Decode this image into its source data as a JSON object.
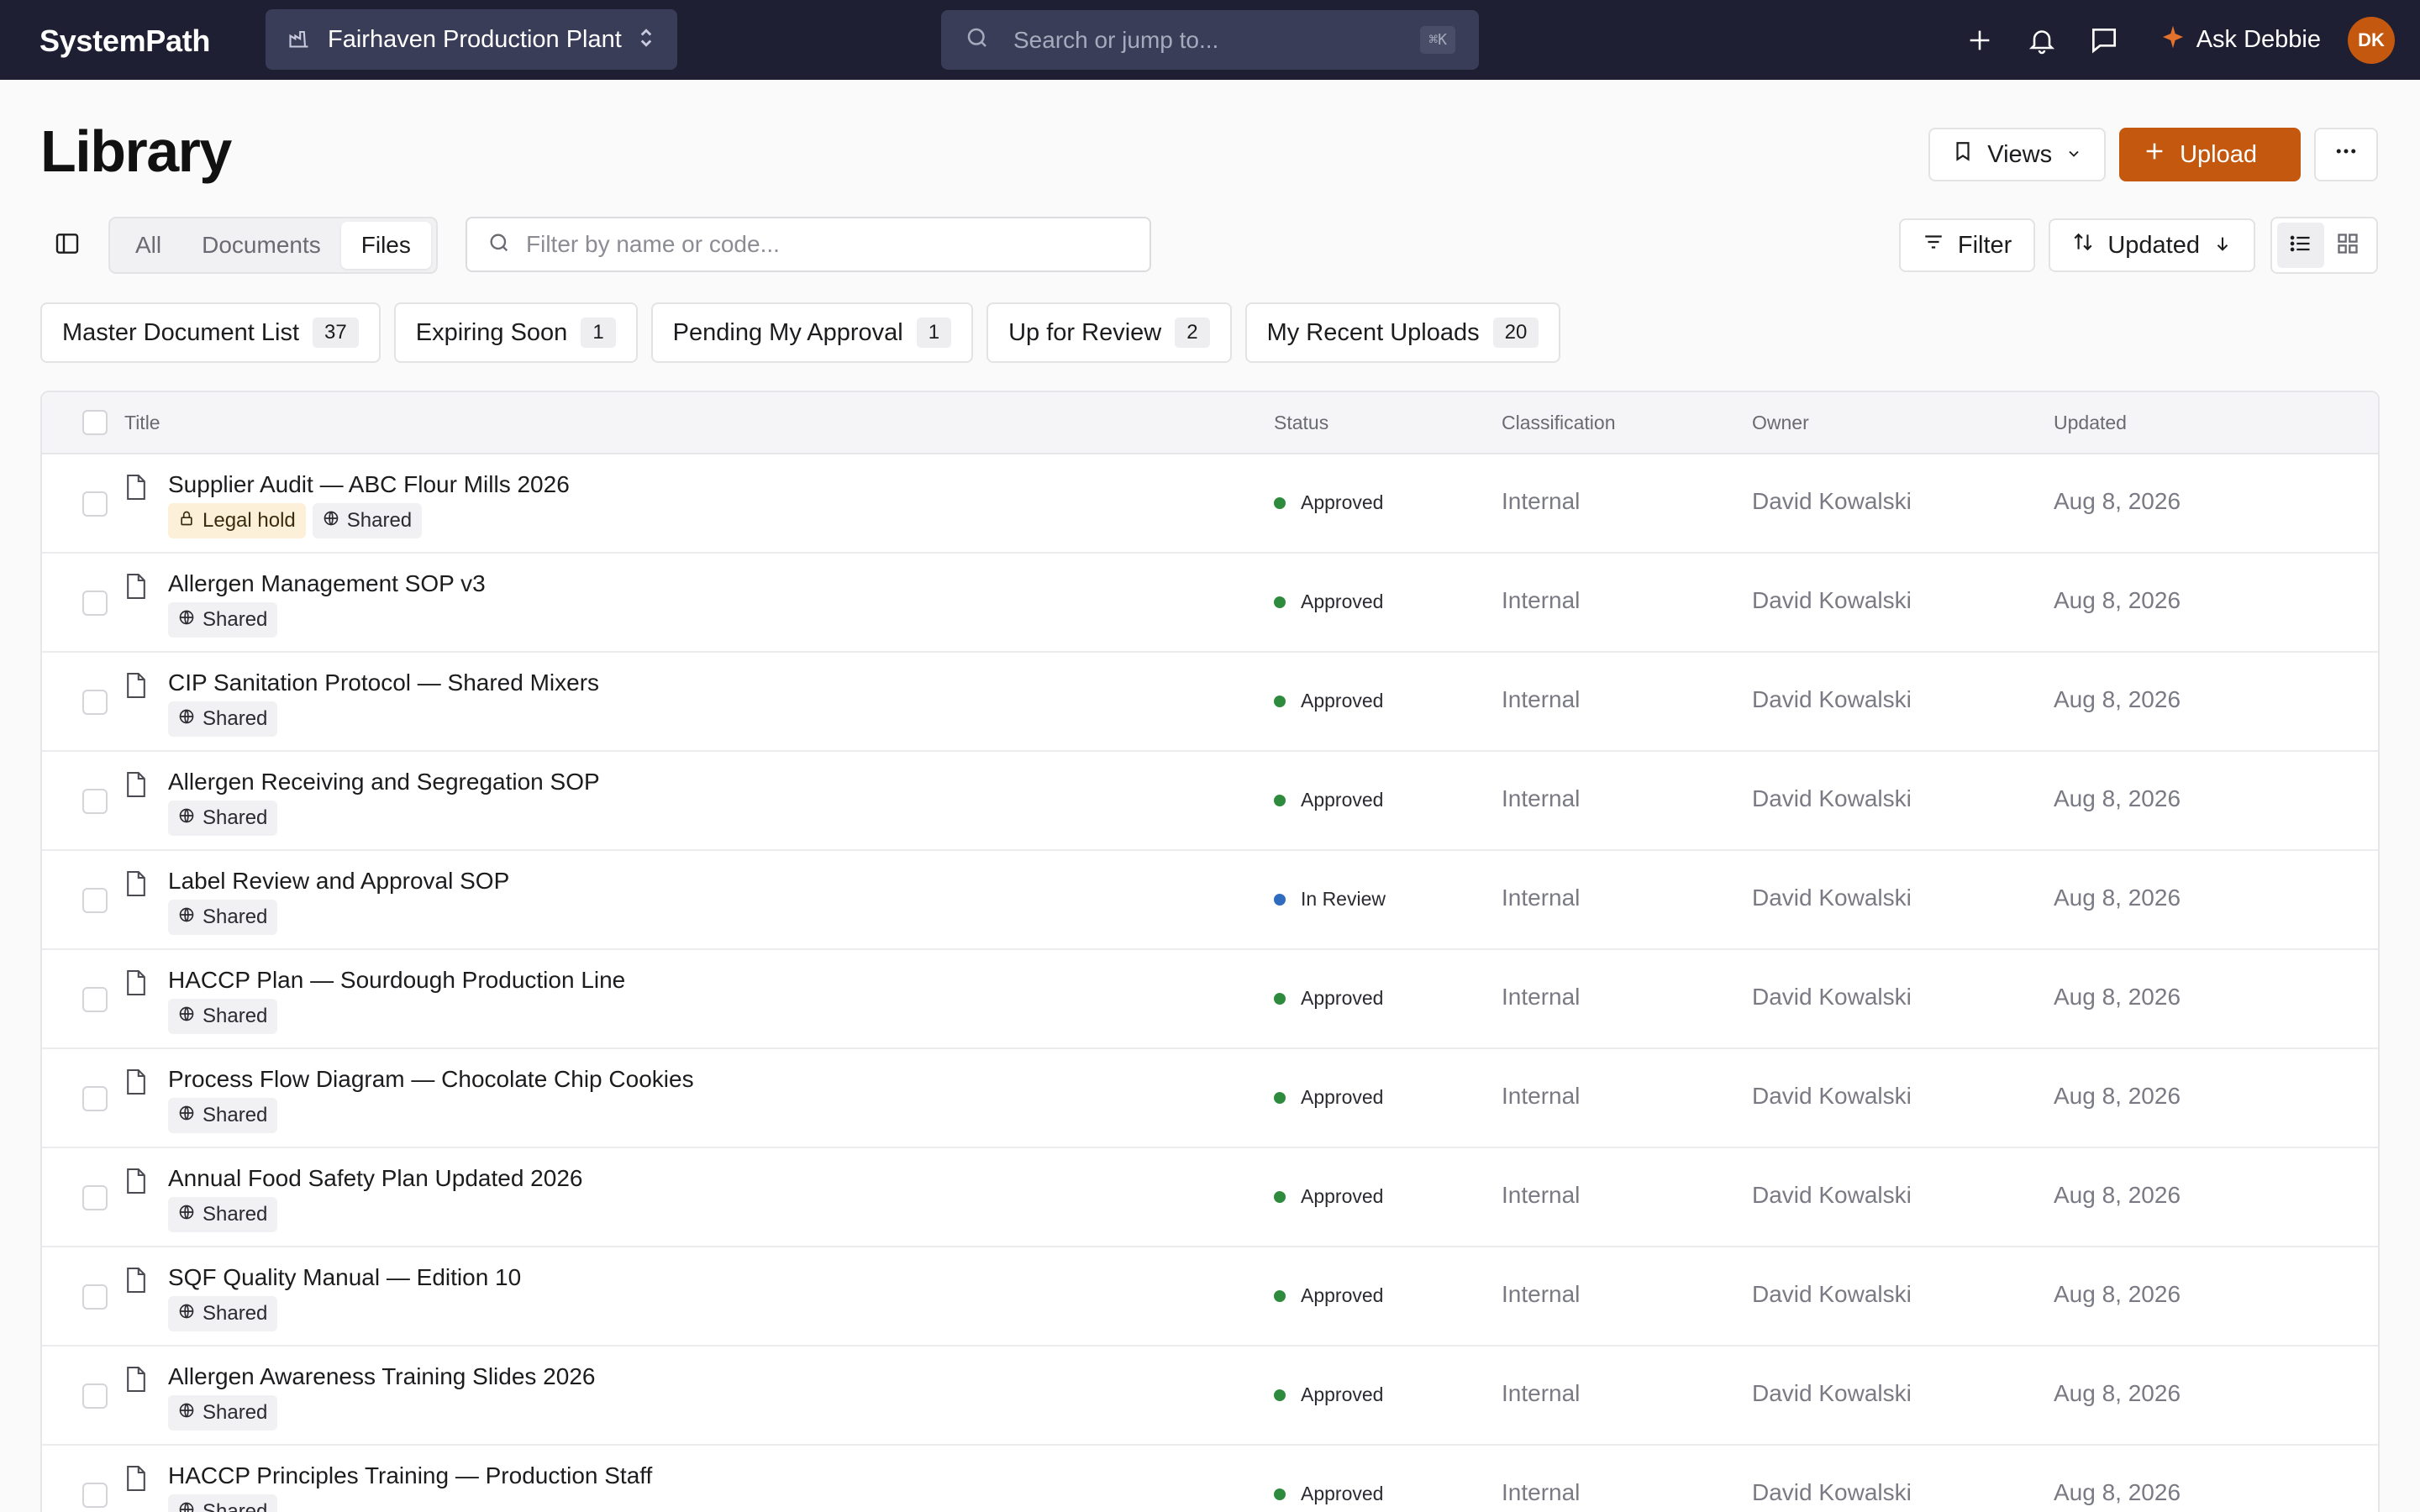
{
  "app": {
    "brand": "SystemPath",
    "plant": "Fairhaven Production Plant",
    "search_placeholder": "Search or jump to...",
    "search_shortcut": "⌘K",
    "assistant_label": "Ask Debbie",
    "user_initials": "DK"
  },
  "header": {
    "title": "Library",
    "views_label": "Views",
    "upload_label": "Upload"
  },
  "toolbar": {
    "tabs": [
      "All",
      "Documents",
      "Files"
    ],
    "active_tab": "Files",
    "filter_placeholder": "Filter by name or code...",
    "filter_label": "Filter",
    "sort_label": "Updated",
    "view_mode": "list"
  },
  "saved_views": [
    {
      "label": "Master Document List",
      "count": "37"
    },
    {
      "label": "Expiring Soon",
      "count": "1"
    },
    {
      "label": "Pending My Approval",
      "count": "1"
    },
    {
      "label": "Up for Review",
      "count": "2"
    },
    {
      "label": "My Recent Uploads",
      "count": "20"
    }
  ],
  "table": {
    "columns": {
      "title": "Title",
      "status": "Status",
      "classification": "Classification",
      "owner": "Owner",
      "updated": "Updated"
    },
    "status_colors": {
      "Approved": "#2e8b3e",
      "In Review": "#2f6bbf"
    },
    "rows": [
      {
        "title": "Supplier Audit — ABC Flour Mills 2026",
        "tags": [
          "Legal hold",
          "Shared"
        ],
        "status": "Approved",
        "classification": "Internal",
        "owner": "David Kowalski",
        "updated": "Aug 8, 2026"
      },
      {
        "title": "Allergen Management SOP v3",
        "tags": [
          "Shared"
        ],
        "status": "Approved",
        "classification": "Internal",
        "owner": "David Kowalski",
        "updated": "Aug 8, 2026"
      },
      {
        "title": "CIP Sanitation Protocol — Shared Mixers",
        "tags": [
          "Shared"
        ],
        "status": "Approved",
        "classification": "Internal",
        "owner": "David Kowalski",
        "updated": "Aug 8, 2026"
      },
      {
        "title": "Allergen Receiving and Segregation SOP",
        "tags": [
          "Shared"
        ],
        "status": "Approved",
        "classification": "Internal",
        "owner": "David Kowalski",
        "updated": "Aug 8, 2026"
      },
      {
        "title": "Label Review and Approval SOP",
        "tags": [
          "Shared"
        ],
        "status": "In Review",
        "classification": "Internal",
        "owner": "David Kowalski",
        "updated": "Aug 8, 2026"
      },
      {
        "title": "HACCP Plan — Sourdough Production Line",
        "tags": [
          "Shared"
        ],
        "status": "Approved",
        "classification": "Internal",
        "owner": "David Kowalski",
        "updated": "Aug 8, 2026"
      },
      {
        "title": "Process Flow Diagram — Chocolate Chip Cookies",
        "tags": [
          "Shared"
        ],
        "status": "Approved",
        "classification": "Internal",
        "owner": "David Kowalski",
        "updated": "Aug 8, 2026"
      },
      {
        "title": "Annual Food Safety Plan Updated 2026",
        "tags": [
          "Shared"
        ],
        "status": "Approved",
        "classification": "Internal",
        "owner": "David Kowalski",
        "updated": "Aug 8, 2026"
      },
      {
        "title": "SQF Quality Manual — Edition 10",
        "tags": [
          "Shared"
        ],
        "status": "Approved",
        "classification": "Internal",
        "owner": "David Kowalski",
        "updated": "Aug 8, 2026"
      },
      {
        "title": "Allergen Awareness Training Slides 2026",
        "tags": [
          "Shared"
        ],
        "status": "Approved",
        "classification": "Internal",
        "owner": "David Kowalski",
        "updated": "Aug 8, 2026"
      },
      {
        "title": "HACCP Principles Training — Production Staff",
        "tags": [
          "Shared"
        ],
        "status": "Approved",
        "classification": "Internal",
        "owner": "David Kowalski",
        "updated": "Aug 8, 2026"
      }
    ]
  }
}
